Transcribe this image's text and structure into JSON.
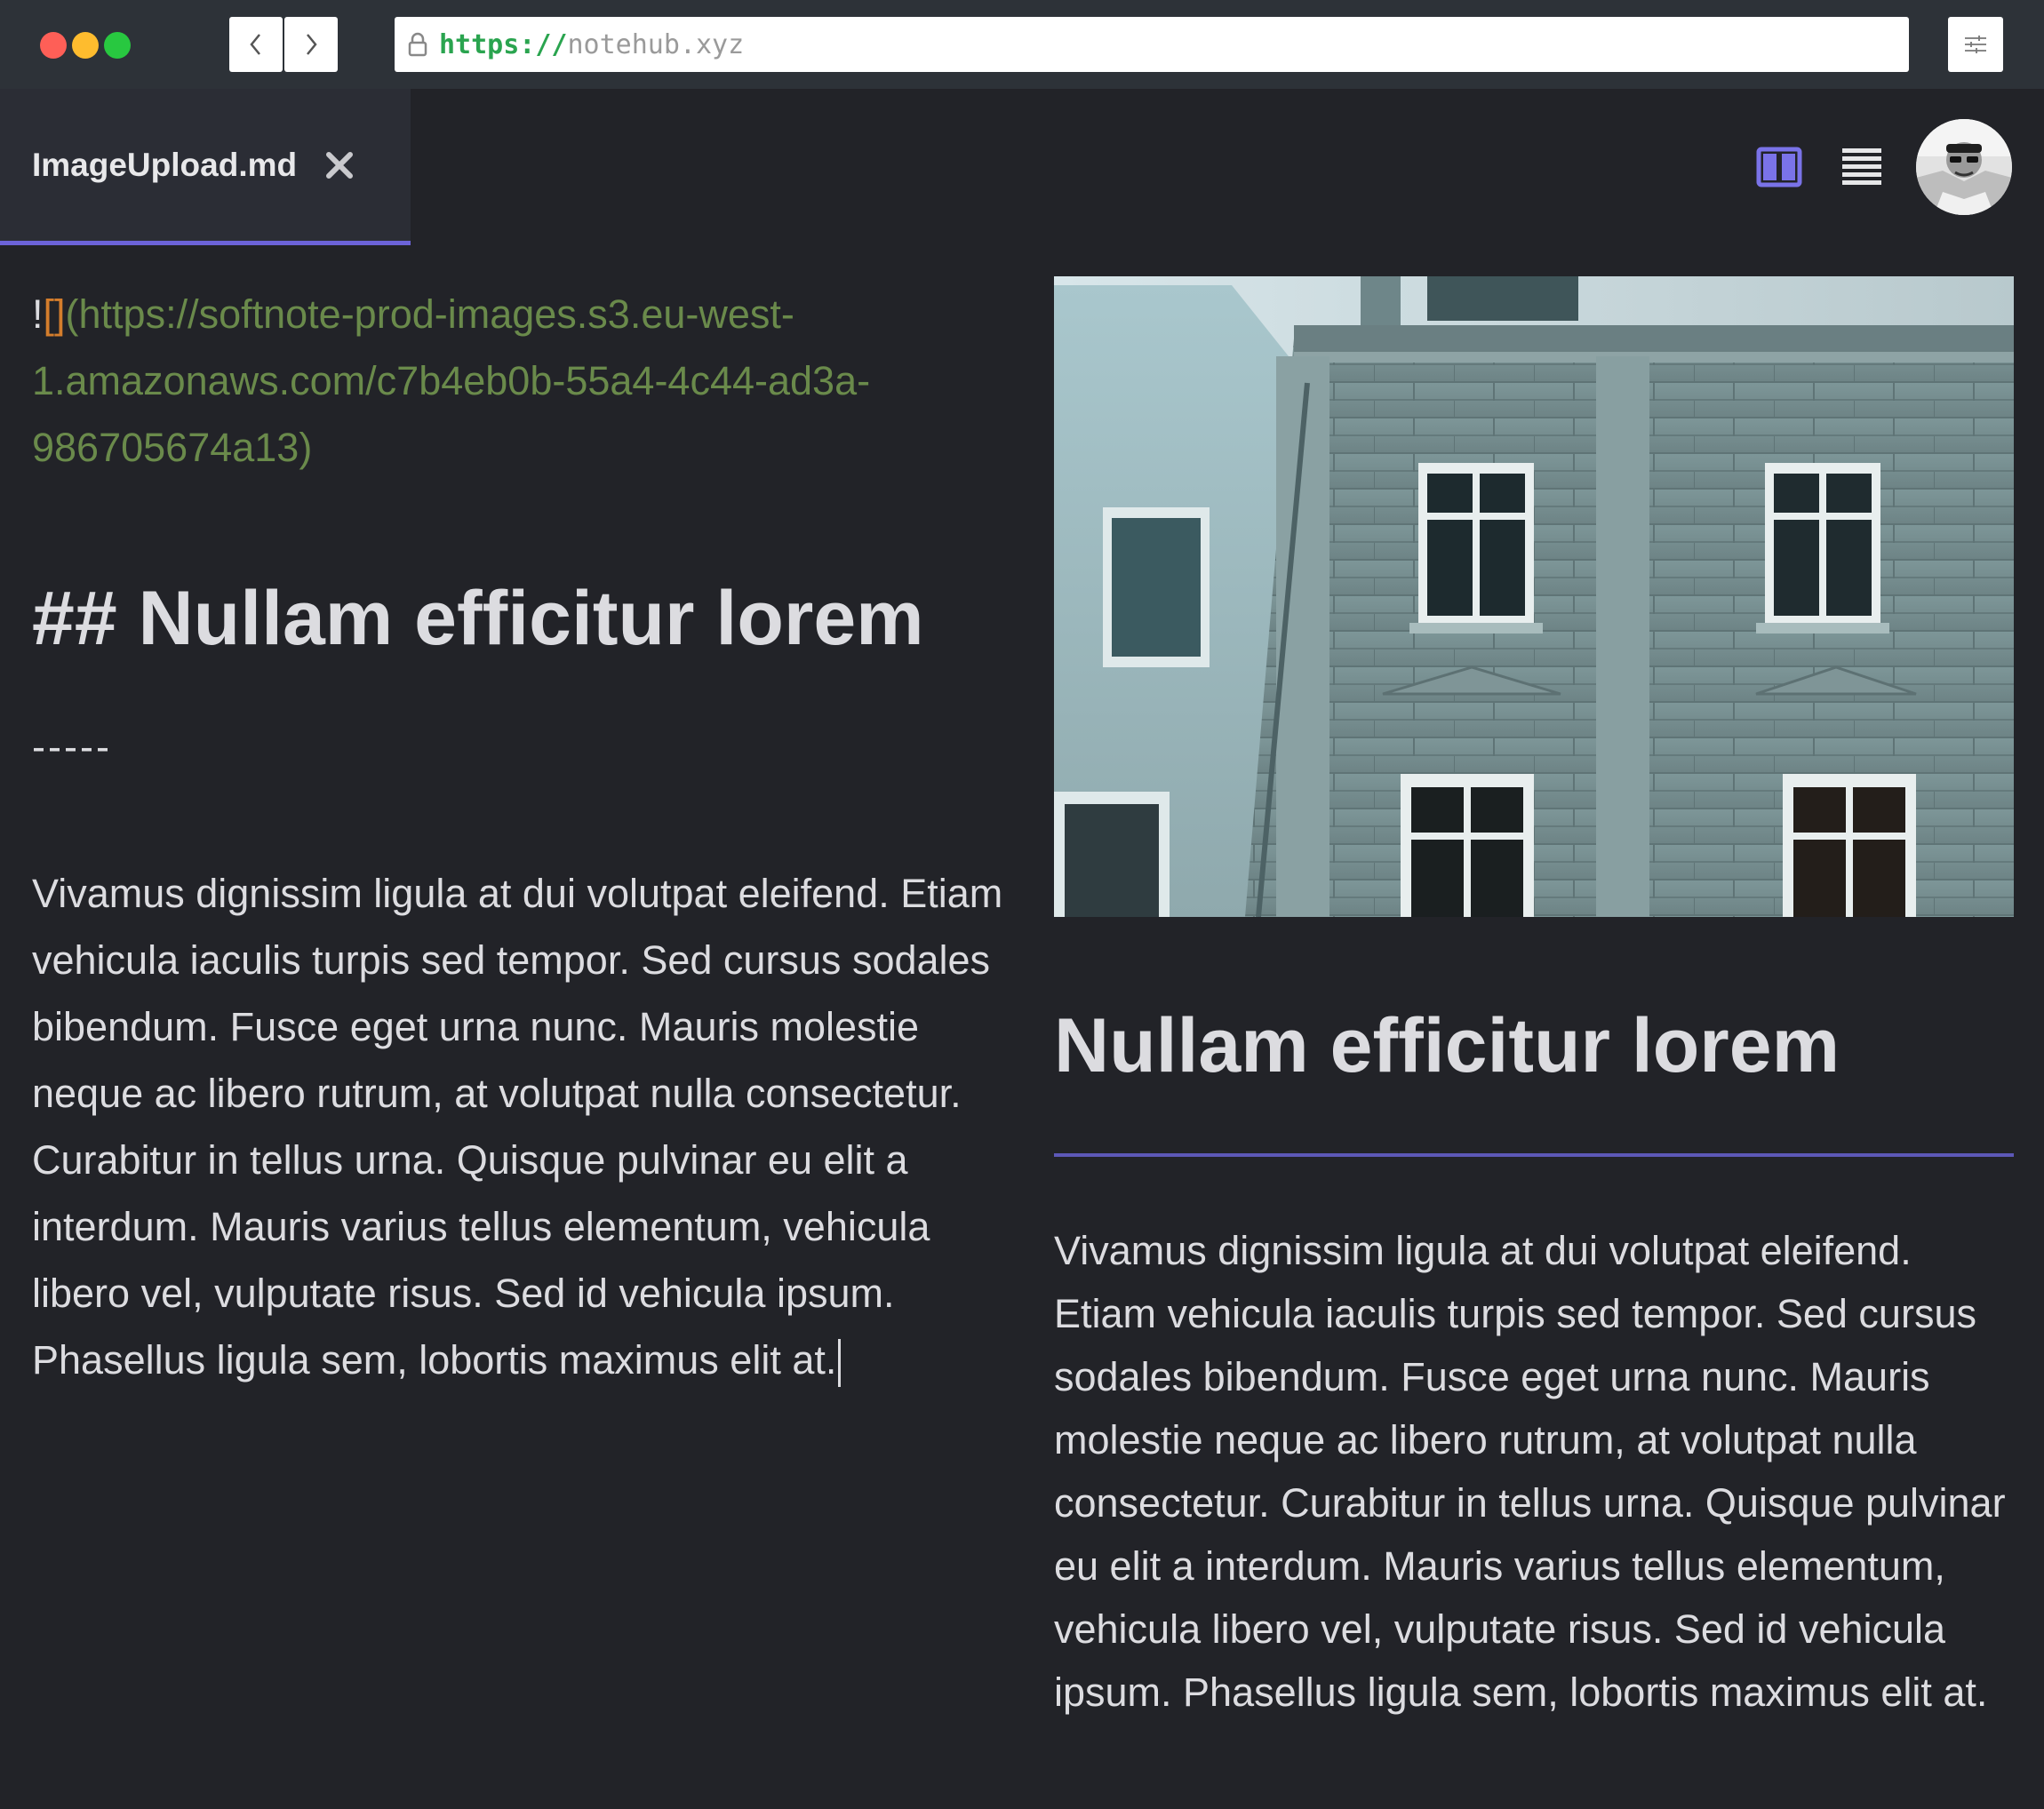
{
  "browser": {
    "url_scheme": "https://",
    "url_host": "notehub.xyz",
    "back_icon": "chevron-left-icon",
    "forward_icon": "chevron-right-icon",
    "settings_icon": "sliders-icon"
  },
  "tab": {
    "label": "ImageUpload.md",
    "close_icon": "close-icon"
  },
  "toolbar": {
    "split_view_icon": "split-view-icon",
    "list_view_icon": "list-view-icon",
    "avatar_icon": "avatar"
  },
  "editor": {
    "image_bang": "!",
    "image_brackets": "[]",
    "image_url": "(https://softnote-prod-images.s3.eu-west-1.amazonaws.com/c7b4eb0b-55a4-4c44-ad3a-986705674a13)",
    "heading": "## Nullam efficitur lorem",
    "rule": "-----",
    "paragraph": "Vivamus dignissim ligula at dui volutpat eleifend. Etiam vehicula iaculis turpis sed tempor. Sed cursus sodales bibendum. Fusce eget urna nunc. Mauris molestie neque ac libero rutrum, at volutpat nulla consectetur. Curabitur in tellus urna. Quisque pulvinar eu elit a interdum. Mauris varius tellus elementum, vehicula libero vel, vulputate risus. Sed id vehicula ipsum. Phasellus ligula sem, lobortis maximus elit at."
  },
  "preview": {
    "heading": "Nullam efficitur lorem",
    "paragraph": "Vivamus dignissim ligula at dui volutpat eleifend. Etiam vehicula iaculis turpis sed tempor. Sed cursus sodales bibendum. Fusce eget urna nunc. Mauris molestie neque ac libero rutrum, at volutpat nulla consectetur. Curabitur in tellus urna. Quisque pulvinar eu elit a interdum. Mauris varius tellus elementum, vehicula libero vel, vulputate risus. Sed id vehicula ipsum. Phasellus ligula sem, lobortis maximus elit at."
  },
  "colors": {
    "background": "#222328",
    "accent": "#6c63d9",
    "link_green": "#6a8a4b",
    "bracket_orange": "#d47d2c"
  }
}
